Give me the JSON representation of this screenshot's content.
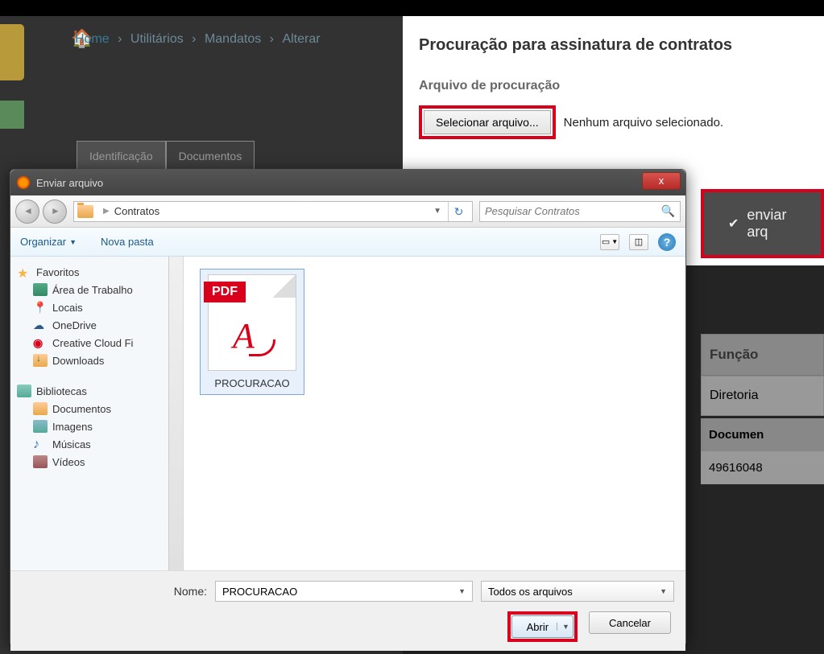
{
  "breadcrumb": {
    "home": "Home",
    "l1": "Utilitários",
    "l2": "Mandatos",
    "l3": "Alterar"
  },
  "bg_tabs": {
    "t1": "Identificação",
    "t2": "Documentos"
  },
  "panel": {
    "title": "Procuração para assinatura de contratos",
    "sublabel": "Arquivo de procuração",
    "select_btn": "Selecionar arquivo...",
    "no_file": "Nenhum arquivo selecionado."
  },
  "enviar": "enviar arq",
  "table": {
    "h1": "Função",
    "r1": "Diretoria",
    "h2": "Documen",
    "r2": "49616048"
  },
  "dialog": {
    "title": "Enviar arquivo",
    "close": "x",
    "path": "Contratos",
    "search_placeholder": "Pesquisar Contratos",
    "organize": "Organizar",
    "new_folder": "Nova pasta",
    "sidebar": {
      "favorites": "Favoritos",
      "desktop": "Área de Trabalho",
      "locais": "Locais",
      "onedrive": "OneDrive",
      "cc": "Creative Cloud Fi",
      "downloads": "Downloads",
      "libraries": "Bibliotecas",
      "docs": "Documentos",
      "images": "Imagens",
      "music": "Músicas",
      "videos": "Vídeos"
    },
    "file": {
      "badge": "PDF",
      "name": "PROCURACAO"
    },
    "bottom": {
      "name_label": "Nome:",
      "name_value": "PROCURACAO",
      "type_value": "Todos os arquivos",
      "open": "Abrir",
      "cancel": "Cancelar"
    }
  }
}
